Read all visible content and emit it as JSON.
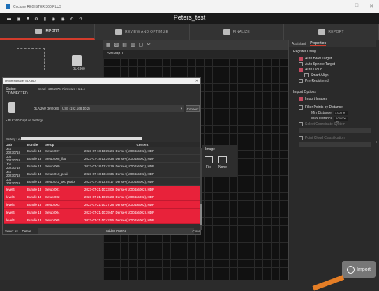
{
  "window": {
    "title": "Cyclone REGISTER 360 PLUS",
    "controls": [
      "—",
      "□",
      "✕"
    ]
  },
  "project": {
    "name": "Peters_test"
  },
  "steps": [
    {
      "label": "IMPORT",
      "icon": "import-icon"
    },
    {
      "label": "REVIEW AND OPTIMIZE",
      "icon": "search-icon"
    },
    {
      "label": "FINALIZE",
      "icon": "check-icon"
    },
    {
      "label": "REPORT",
      "icon": "report-icon"
    }
  ],
  "left_panel": {
    "device_label": "BLK360"
  },
  "viewer": {
    "sitemap_tab": "SiteMap 1"
  },
  "image_popup": {
    "heading": "Image",
    "options": [
      "File",
      "None"
    ]
  },
  "right_panel": {
    "tabs": [
      "Assistant",
      "Properties"
    ],
    "register_using": "Register Using",
    "register_options": [
      {
        "label": "Auto B&W Target",
        "checked": true
      },
      {
        "label": "Auto Sphere Target",
        "checked": false
      },
      {
        "label": "Auto Cloud",
        "checked": true
      },
      {
        "label": "Smart Align",
        "checked": false
      },
      {
        "label": "Pre-Registered",
        "checked": false
      }
    ],
    "import_options": "Import Options",
    "import_images": "Import Images",
    "filter_points": "Filter Points by Distance",
    "min_distance": {
      "label": "Min Distance",
      "value": "1.000 m"
    },
    "max_distance": {
      "label": "Max Distance",
      "value": "100.000 m"
    },
    "select_coord": "Select Coordinate System",
    "point_cloud_class": "Point Cloud Classification",
    "import_button": "Import"
  },
  "dialog": {
    "title": "Import Manager BLK360",
    "status_label": "Status:",
    "status_value": "CONNECTED",
    "serial": "Serial : 2061576, Firmware : 1.2.4",
    "devices_label": "BLK360 devices:",
    "devices_value": "USB (192.168.10.2)",
    "connect": "Connect",
    "capture_settings": "BLK360 Capture Settings",
    "battery_label": "Battery Level:",
    "columns": [
      "Job",
      "Bundle",
      "Setup",
      "Content"
    ],
    "rows": [
      {
        "job": "Job 20230718",
        "bundle": "Bundle 13",
        "setup": "Setup 007",
        "content": "2023-07-18-13:35:24, Dense+(10004x5002), HDR",
        "selected": false
      },
      {
        "job": "Job 20230718",
        "bundle": "Bundle 13",
        "setup": "Setup 008_flat",
        "content": "2023-07-18-13:39:38, Dense+(10004x5002), HDR",
        "selected": false
      },
      {
        "job": "Job 20230718",
        "bundle": "Bundle 13",
        "setup": "Setup 009",
        "content": "2023-07-18-13:43:19, Dense+(10004x5002), HDR",
        "selected": false
      },
      {
        "job": "Job 20230718",
        "bundle": "Bundle 13",
        "setup": "Setup 010_peak",
        "content": "2023-07-18-13:48:36, Dense+(10004x5002), HDR",
        "selected": false
      },
      {
        "job": "Job 20230718",
        "bundle": "Bundle 13",
        "setup": "Setup 011_two peaks",
        "content": "2023-07-18-13:54:17, Dense+(10004x5002), HDR",
        "selected": false
      },
      {
        "job": "level4",
        "bundle": "Bundle 13",
        "setup": "Setup 001",
        "content": "2023-07-21-10:33:09, Dense+(10004x5002), HDR",
        "selected": true
      },
      {
        "job": "level4",
        "bundle": "Bundle 13",
        "setup": "Setup 002",
        "content": "2023-07-21-10:35:23, Dense+(10004x5002), HDR",
        "selected": true
      },
      {
        "job": "level4",
        "bundle": "Bundle 13",
        "setup": "Setup 003",
        "content": "2023-07-21-10:37:28, Dense+(10004x5002), HDR",
        "selected": true
      },
      {
        "job": "level4",
        "bundle": "Bundle 13",
        "setup": "Setup 004",
        "content": "2023-07-21-10:39:47, Dense+(10004x5002), HDR",
        "selected": true
      },
      {
        "job": "level4",
        "bundle": "Bundle 13",
        "setup": "Setup 005",
        "content": "2023-07-21-10:42:56, Dense+(10004x5002), HDR",
        "selected": true
      }
    ],
    "select_all": "Select All",
    "delete": "Delete",
    "add_to_project": "Add to Project",
    "close": "Close"
  },
  "colors": {
    "accent": "#d23c2c",
    "selection": "#e8223a",
    "checkbox": "#c64a60",
    "hint_arrow": "#e57e26"
  }
}
